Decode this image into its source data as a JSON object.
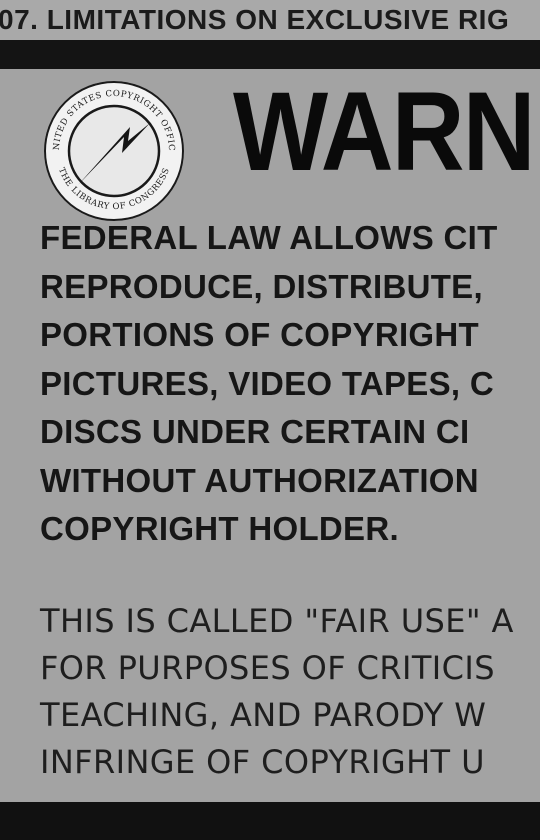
{
  "header": {
    "text": "07. LIMITATIONS ON EXCLUSIVE RIG"
  },
  "seal": {
    "icon": "copyright-office-seal-icon",
    "top_text": "UNITED STATES COPYRIGHT OFFICE",
    "bottom_text": "THE LIBRARY OF CONGRESS"
  },
  "notice": {
    "title": "WARNI",
    "bold_lines": [
      "FEDERAL LAW ALLOWS CIT",
      "REPRODUCE, DISTRIBUTE,",
      "PORTIONS OF COPYRIGHT",
      "PICTURES, VIDEO TAPES, C",
      "DISCS UNDER CERTAIN CI",
      "WITHOUT AUTHORIZATION",
      "COPYRIGHT HOLDER."
    ],
    "light_lines": [
      "THIS IS CALLED \"FAIR USE\" A",
      "FOR PURPOSES OF CRITICIS",
      "TEACHING, AND PARODY W",
      "INFRINGE OF COPYRIGHT U"
    ]
  },
  "colors": {
    "background": "#a9a9a9",
    "frame": "#141414",
    "text": "#161616"
  }
}
